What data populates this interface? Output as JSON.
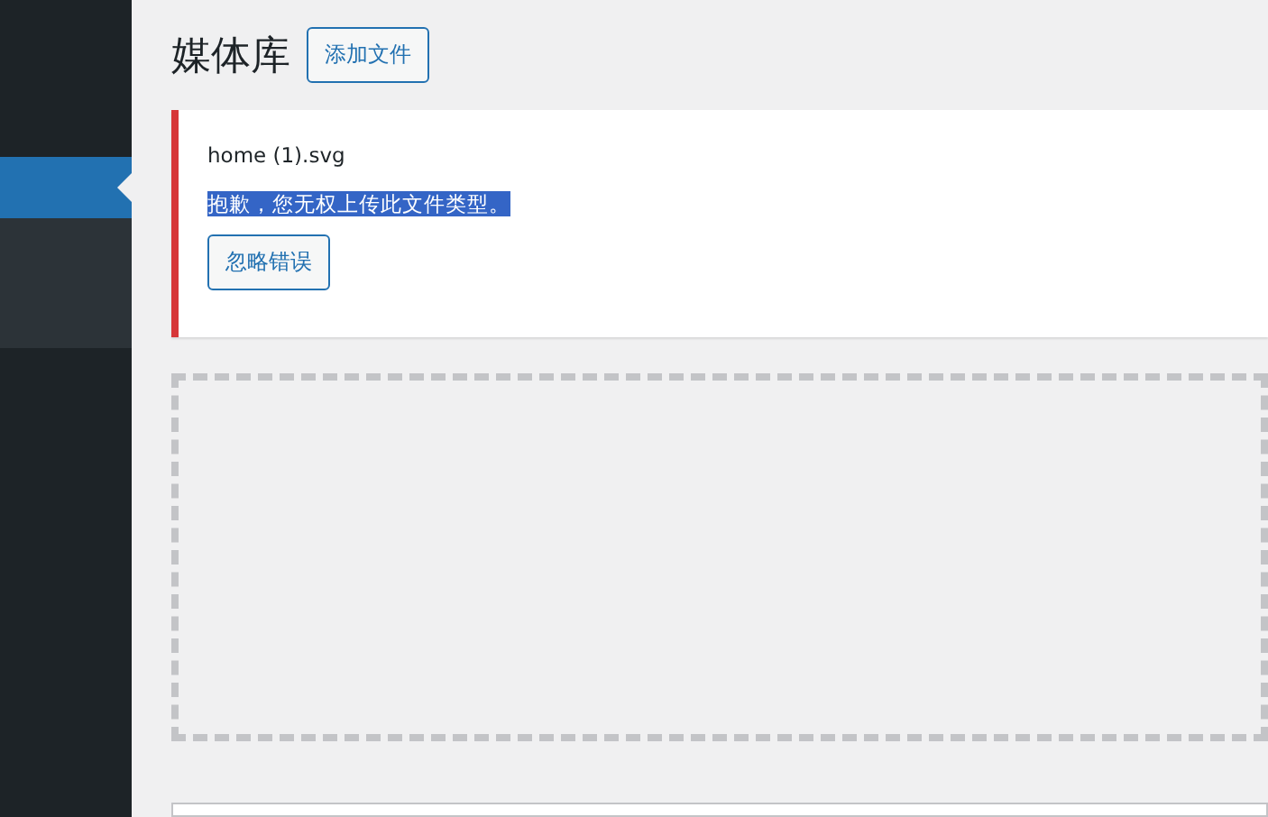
{
  "sidebar": {
    "items": [
      {
        "selected": true
      },
      {
        "selected": false
      }
    ]
  },
  "page": {
    "title": "媒体库",
    "add_button": "添加文件"
  },
  "notice": {
    "filename": "home (1).svg",
    "message": "抱歉，您无权上传此文件类型。",
    "highlighted": true,
    "dismiss_button": "忽略错误"
  }
}
